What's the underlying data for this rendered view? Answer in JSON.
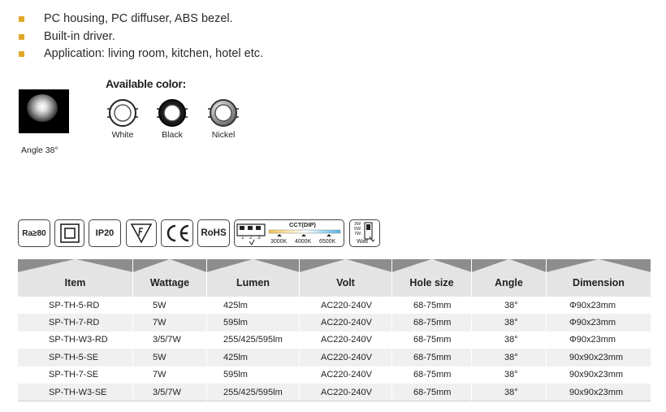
{
  "features": [
    "PC housing, PC diffuser, ABS bezel.",
    "Built-in driver.",
    "Application: living room, kitchen, hotel etc."
  ],
  "beam": {
    "angle_label": "Angle 38°"
  },
  "colors": {
    "title": "Available color:",
    "options": [
      {
        "name": "White",
        "ring": "#ffffff"
      },
      {
        "name": "Black",
        "ring": "#1a1a1a"
      },
      {
        "name": "Nickel",
        "ring": "#a8a8a8"
      }
    ]
  },
  "certifications": {
    "ra": "Ra≥80",
    "ip": "IP20",
    "rohs": "RoHS",
    "cct_title": "CCT(DIP)",
    "cct_switch_numbers": [
      "1",
      "2",
      "3"
    ],
    "cct_values": [
      "3000K",
      "4000K",
      "6500K"
    ],
    "watt_options": [
      "3W",
      "5W",
      "7W"
    ],
    "watt_label": "Watt"
  },
  "table": {
    "headers": [
      "Item",
      "Wattage",
      "Lumen",
      "Volt",
      "Hole size",
      "Angle",
      "Dimension"
    ],
    "rows": [
      [
        "SP-TH-5-RD",
        "5W",
        "425lm",
        "AC220-240V",
        "68-75mm",
        "38°",
        "Φ90x23mm"
      ],
      [
        "SP-TH-7-RD",
        "7W",
        "595lm",
        "AC220-240V",
        "68-75mm",
        "38°",
        "Φ90x23mm"
      ],
      [
        "SP-TH-W3-RD",
        "3/5/7W",
        "255/425/595lm",
        "AC220-240V",
        "68-75mm",
        "38°",
        "Φ90x23mm"
      ],
      [
        "SP-TH-5-SE",
        "5W",
        "425lm",
        "AC220-240V",
        "68-75mm",
        "38°",
        "90x90x23mm"
      ],
      [
        "SP-TH-7-SE",
        "7W",
        "595lm",
        "AC220-240V",
        "68-75mm",
        "38°",
        "90x90x23mm"
      ],
      [
        "SP-TH-W3-SE",
        "3/5/7W",
        "255/425/595lm",
        "AC220-240V",
        "68-75mm",
        "38°",
        "90x90x23mm"
      ]
    ]
  }
}
